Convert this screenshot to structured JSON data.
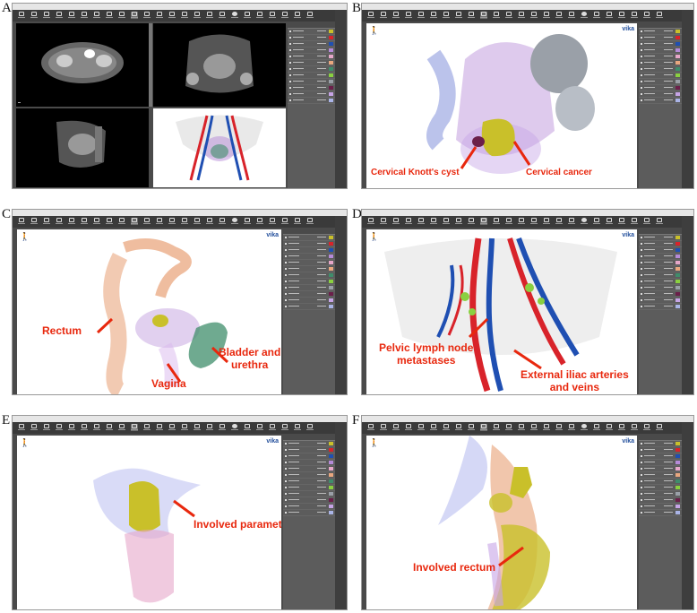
{
  "panels": [
    {
      "letter": "A"
    },
    {
      "letter": "B",
      "labels": [
        "Cervical Knott's cyst",
        "Cervical cancer"
      ]
    },
    {
      "letter": "C",
      "labels": [
        "Rectum",
        "Bladder and\nurethra",
        "Vagina"
      ]
    },
    {
      "letter": "D",
      "labels": [
        "Pelvic lymph node\nmetastases",
        "External iliac arteries\nand veins"
      ]
    },
    {
      "letter": "E",
      "labels": [
        "Involved parametria"
      ]
    },
    {
      "letter": "F",
      "labels": [
        "Involved rectum"
      ]
    }
  ],
  "logo_text": "vika",
  "colors": {
    "label_red": "#e8280e",
    "window_gray": "#4a4a4a",
    "tumor_yellow": "#c9c02a",
    "vessel_red": "#d8232a",
    "vessel_blue": "#1f4fb2",
    "organ_purple": "#b58ad8",
    "organ_pink": "#e6a7c9",
    "rectum_orange": "#e9a77f",
    "bladder_green": "#3f8d6b"
  },
  "icons": [
    "toolbar-tool-icon",
    "traffic-light-icon",
    "human-figure-icon",
    "arrow-annotation-icon"
  ]
}
